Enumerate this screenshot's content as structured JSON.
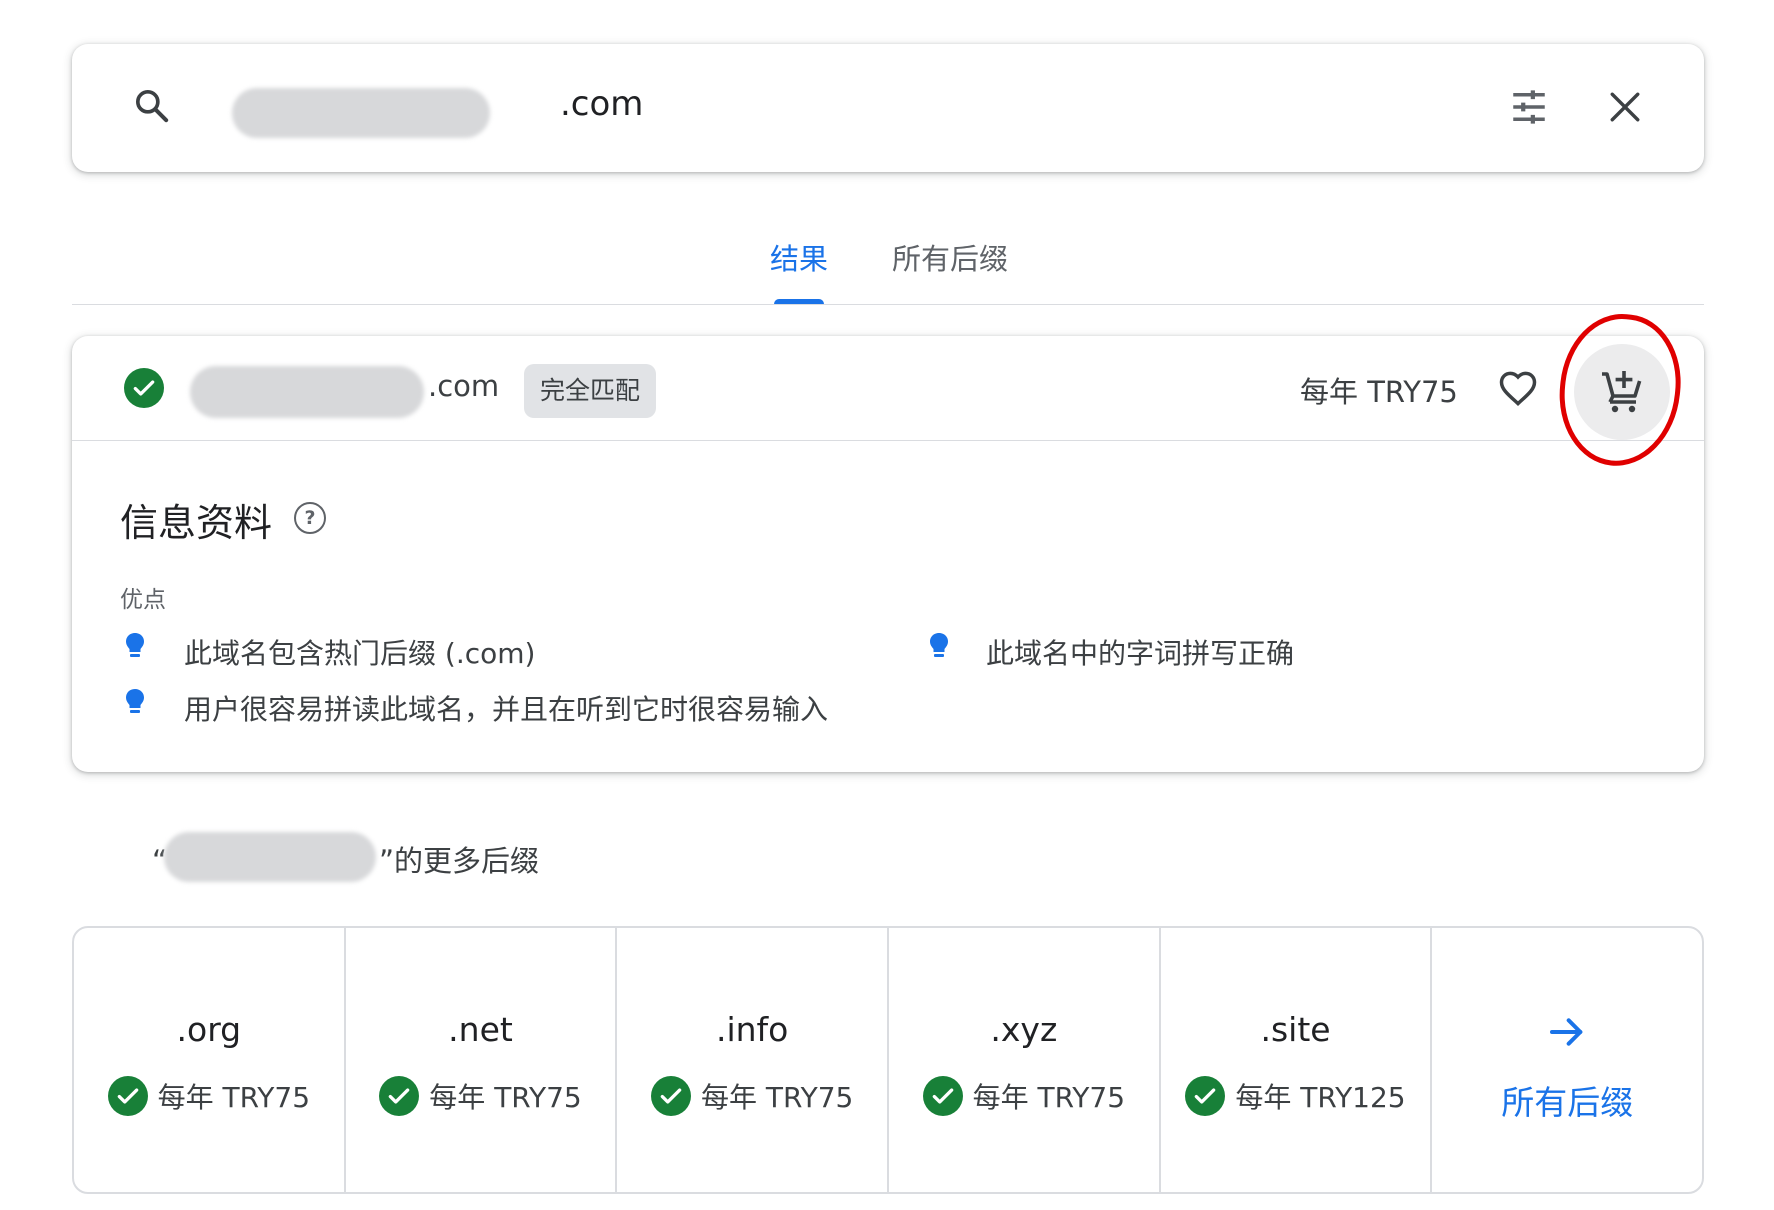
{
  "search": {
    "suffix": ".com"
  },
  "tabs": [
    {
      "label": "结果",
      "active": true
    },
    {
      "label": "所有后缀",
      "active": false
    }
  ],
  "result": {
    "suffix": ".com",
    "badge": "完全匹配",
    "price": "每年 TRY75",
    "info_title": "信息资料",
    "help_glyph": "?",
    "pros_label": "优点",
    "pros": [
      "此域名包含热门后缀 (.com)",
      "此域名中的字词拼写正确",
      "用户很容易拼读此域名，并且在听到它时很容易输入"
    ]
  },
  "more": {
    "label_open": "“",
    "label_close": "”的更多后缀",
    "tlds": [
      {
        "name": ".org",
        "price": "每年 TRY75"
      },
      {
        "name": ".net",
        "price": "每年 TRY75"
      },
      {
        "name": ".info",
        "price": "每年 TRY75"
      },
      {
        "name": ".xyz",
        "price": "每年 TRY75"
      },
      {
        "name": ".site",
        "price": "每年 TRY125"
      }
    ],
    "all_label": "所有后缀"
  },
  "colors": {
    "accent": "#1a73e8",
    "success": "#188038",
    "annotation": "#e00000"
  },
  "icons": [
    "search-icon",
    "tune-icon",
    "close-icon",
    "check-icon",
    "heart-icon",
    "add-cart-icon",
    "help-icon",
    "lightbulb-icon",
    "arrow-right-icon"
  ]
}
